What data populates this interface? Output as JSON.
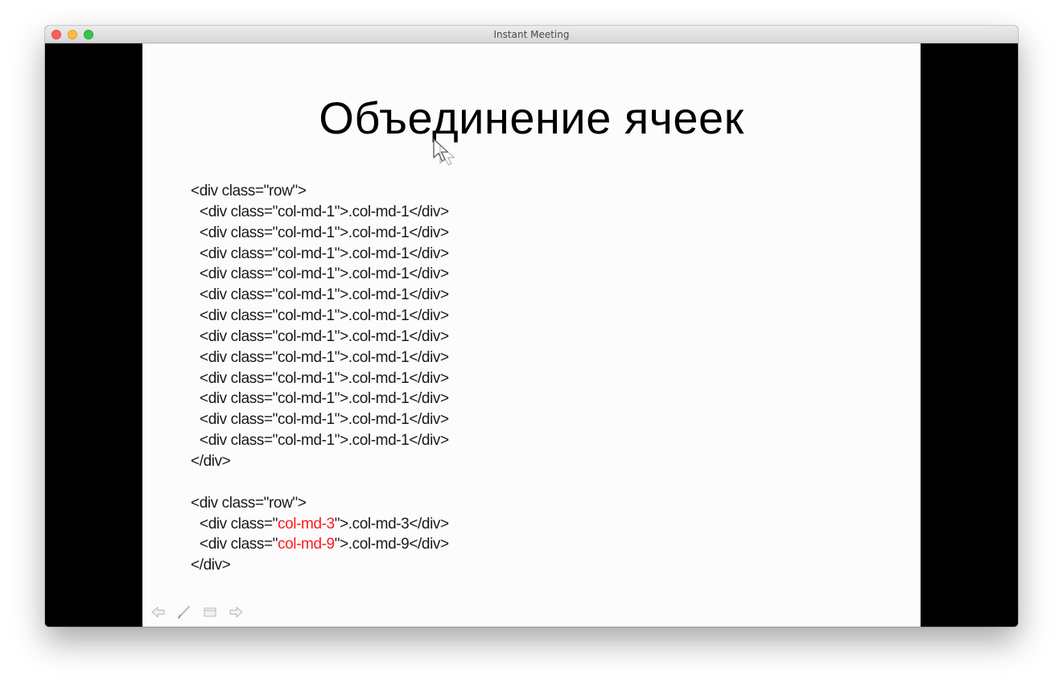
{
  "window": {
    "title": "Instant Meeting"
  },
  "slide": {
    "title": "Объединение ячеек",
    "block1": {
      "open": "<div class=\"row\">",
      "rows": [
        {
          "pre": "<div class=\"",
          "cls": "col-md-1",
          "post": "\">.col-md-1</div>"
        },
        {
          "pre": "<div class=\"",
          "cls": "col-md-1",
          "post": "\">.col-md-1</div>"
        },
        {
          "pre": "<div class=\"",
          "cls": "col-md-1",
          "post": "\">.col-md-1</div>"
        },
        {
          "pre": "<div class=\"",
          "cls": "col-md-1",
          "post": "\">.col-md-1</div>"
        },
        {
          "pre": "<div class=\"",
          "cls": "col-md-1",
          "post": "\">.col-md-1</div>"
        },
        {
          "pre": "<div class=\"",
          "cls": "col-md-1",
          "post": "\">.col-md-1</div>"
        },
        {
          "pre": "<div class=\"",
          "cls": "col-md-1",
          "post": "\">.col-md-1</div>"
        },
        {
          "pre": "<div class=\"",
          "cls": "col-md-1",
          "post": "\">.col-md-1</div>"
        },
        {
          "pre": "<div class=\"",
          "cls": "col-md-1",
          "post": "\">.col-md-1</div>"
        },
        {
          "pre": "<div class=\"",
          "cls": "col-md-1",
          "post": "\">.col-md-1</div>"
        },
        {
          "pre": "<div class=\"",
          "cls": "col-md-1",
          "post": "\">.col-md-1</div>"
        },
        {
          "pre": "<div class=\"",
          "cls": "col-md-1",
          "post": "\">.col-md-1</div>"
        }
      ],
      "close": "</div>"
    },
    "block2": {
      "open": "<div class=\"row\">",
      "rows": [
        {
          "pre": "<div class=\"",
          "cls": "col-md-3",
          "post": "\">.col-md-3</div>"
        },
        {
          "pre": "<div class=\"",
          "cls": "col-md-9",
          "post": "\">.col-md-9</div>"
        }
      ],
      "close": "</div>"
    },
    "controls": [
      {
        "name": "prev-slide-arrow-icon"
      },
      {
        "name": "pen-icon"
      },
      {
        "name": "slide-menu-icon"
      },
      {
        "name": "next-slide-arrow-icon"
      }
    ]
  },
  "colors": {
    "highlight": "#ff1a1a",
    "slide_background": "#fdfcfd",
    "stage_background": "#000000"
  }
}
